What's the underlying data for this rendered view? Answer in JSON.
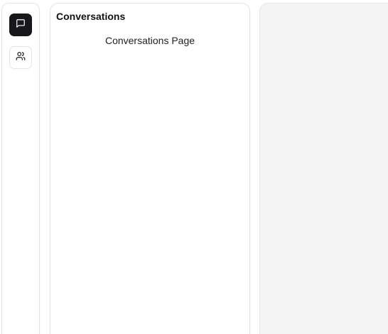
{
  "nav": {
    "items": [
      {
        "id": "conversations",
        "icon": "message-square-icon",
        "active": true
      },
      {
        "id": "contacts",
        "icon": "users-icon",
        "active": false
      }
    ]
  },
  "conversations_panel": {
    "title": "Conversations",
    "content_text": "Conversations Page"
  },
  "colors": {
    "active_nav_bg": "#18181b",
    "border": "#e4e4e7",
    "detail_bg": "#f4f4f5"
  }
}
